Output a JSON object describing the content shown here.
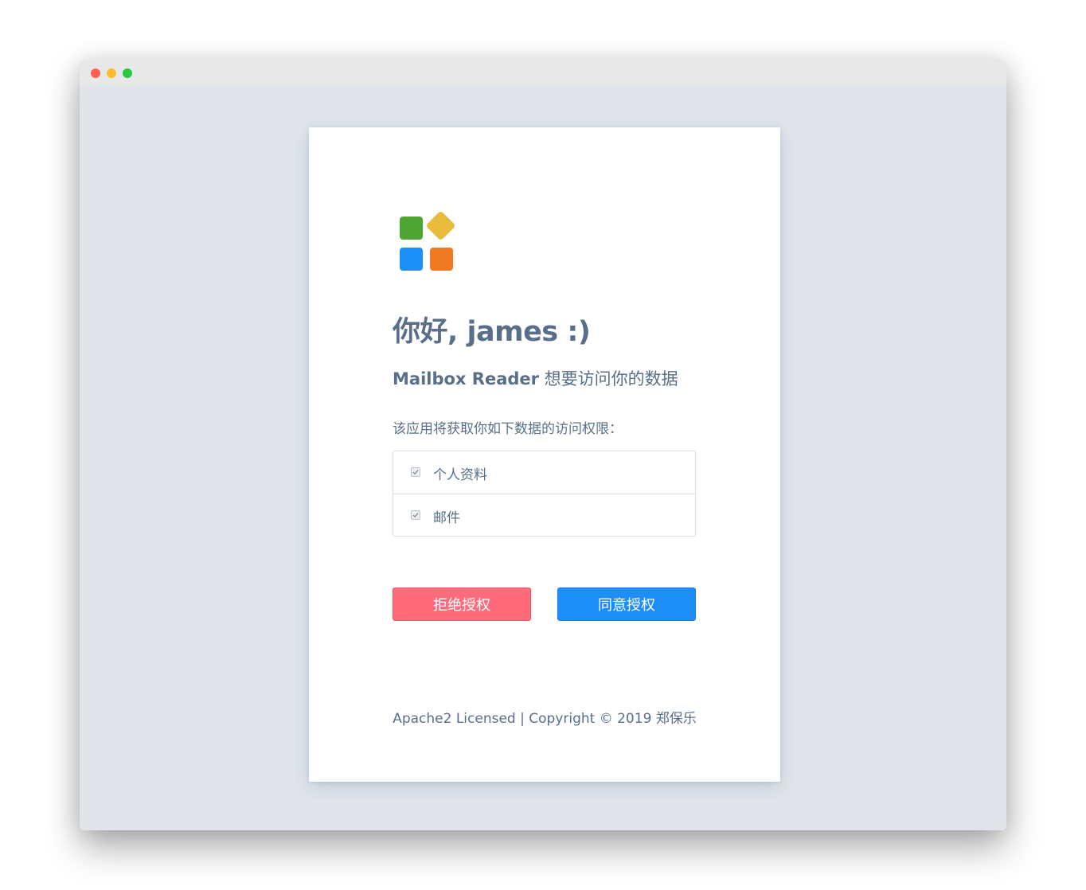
{
  "window": {
    "traffic_lights": [
      "close",
      "minimize",
      "maximize"
    ]
  },
  "logo": {
    "icon": "app-grid-logo",
    "colors": {
      "green": "#4ea531",
      "yellow": "#e8bb3d",
      "blue": "#1b8ff8",
      "orange": "#f07a21"
    }
  },
  "greeting": "你好, james :)",
  "subtitle": {
    "app_name": "Mailbox Reader",
    "suffix": " 想要访问你的数据"
  },
  "description": "该应用将获取你如下数据的访问权限：",
  "permissions": [
    {
      "label": "个人资料",
      "checked": true
    },
    {
      "label": "邮件",
      "checked": true
    }
  ],
  "buttons": {
    "deny": "拒绝授权",
    "allow": "同意授权"
  },
  "footer": "Apache2 Licensed | Copyright © 2019 郑保乐",
  "colors": {
    "deny": "#ff6b7b",
    "allow": "#1d8ef8",
    "text": "#596f89",
    "background": "#e1e5ea"
  }
}
